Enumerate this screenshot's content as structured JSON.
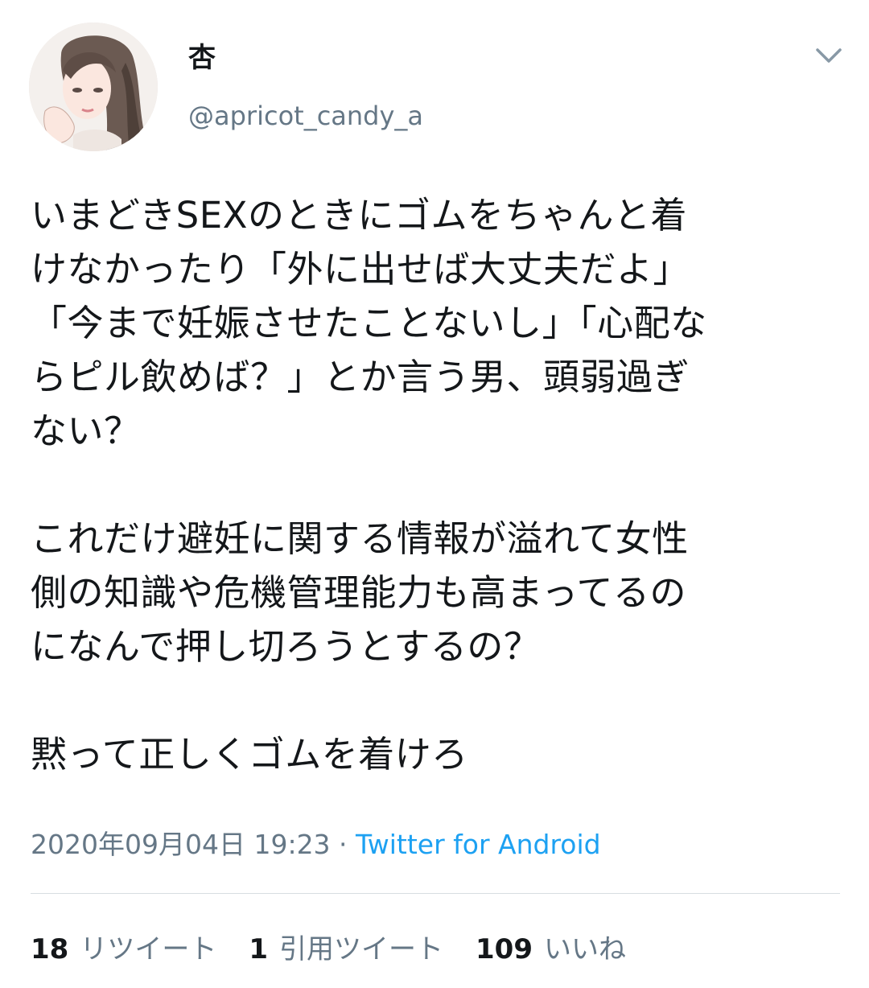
{
  "user": {
    "display_name": "杏",
    "handle": "@apricot_candy_a"
  },
  "tweet": {
    "lines": [
      "いまどきSEXのときにゴムをちゃんと着",
      "けなかったり「外に出せば大丈夫だよ」",
      "「今まで妊娠させたことないし」「心配な",
      "らピル飲めば？」とか言う男、頭弱過ぎ",
      "ない？",
      "",
      "これだけ避妊に関する情報が溢れて女性",
      "側の知識や危機管理能力も高まってるの",
      "になんで押し切ろうとするの？",
      "",
      "黙って正しくゴムを着けろ"
    ],
    "timestamp": "2020年09月04日 19:23",
    "separator": " · ",
    "source": "Twitter for Android"
  },
  "stats": {
    "retweets_count": "18",
    "retweets_label": "リツイート",
    "quotes_count": "1",
    "quotes_label": "引用ツイート",
    "likes_count": "109",
    "likes_label": "いいね"
  },
  "colors": {
    "text": "#14171a",
    "secondary": "#657786",
    "link": "#1da1f2",
    "divider": "#d8dde1"
  },
  "icons": {
    "menu": "chevron-down-icon",
    "avatar": "avatar-illustration"
  }
}
